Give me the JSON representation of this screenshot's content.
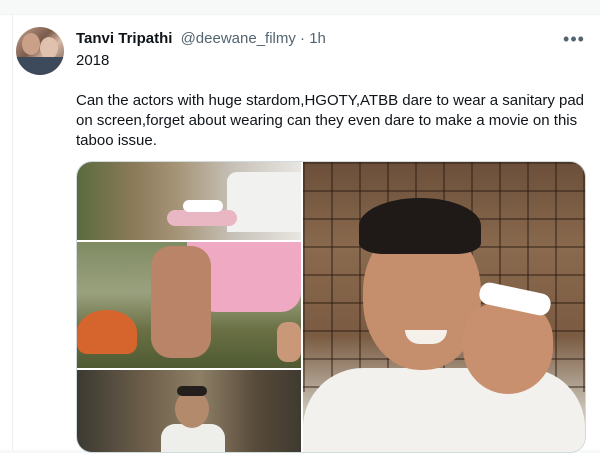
{
  "tweet": {
    "author_name": "Tanvi Tripathi",
    "author_handle": "@deewane_filmy",
    "separator": "·",
    "time": "1h",
    "more_icon": "more-horizontal-icon",
    "text_line1": "2018",
    "text_line2": "Can the actors with huge stardom,HGOTY,ATBB dare to wear a sanitary pad on screen,forget about wearing can they even dare to make a movie on this taboo issue."
  },
  "colors": {
    "text_primary": "#0f1419",
    "text_secondary": "#536471",
    "border": "#cfd9de",
    "background": "#ffffff"
  }
}
